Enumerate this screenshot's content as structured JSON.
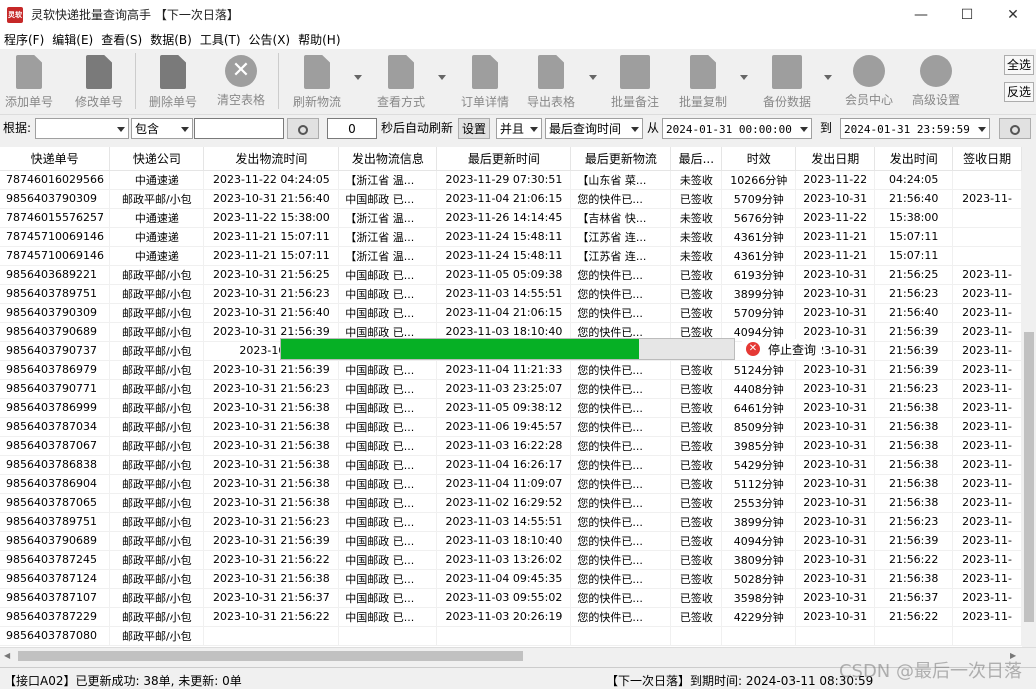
{
  "window": {
    "title": "灵软快递批量查询高手 【下一次日落】",
    "icon_text": "灵软"
  },
  "menu": [
    "程序(F)",
    "编辑(E)",
    "查看(S)",
    "数据(B)",
    "工具(T)",
    "公告(X)",
    "帮助(H)"
  ],
  "toolbar": {
    "add": "添加单号",
    "edit": "修改单号",
    "delete": "删除单号",
    "clear": "清空表格",
    "refresh": "刷新物流",
    "view_mode": "查看方式",
    "detail": "订单详情",
    "export": "导出表格",
    "batch_note": "批量备注",
    "batch_copy": "批量复制",
    "backup": "备份数据",
    "member": "会员中心",
    "settings": "高级设置",
    "select_all": "全选",
    "invert": "反选"
  },
  "search": {
    "by_label": "根据:",
    "by_value": "",
    "match_value": "包含",
    "keyword": "",
    "interval": "0",
    "interval_suffix": "秒后自动刷新",
    "set_btn": "设置",
    "logic": "并且",
    "time_field": "最后查询时间",
    "from_label": "从",
    "from_value": "2024-01-31 00:00:00",
    "to_label": "到",
    "to_value": "2024-01-31 23:59:59"
  },
  "table": {
    "columns": [
      "快递单号",
      "快递公司",
      "发出物流时间",
      "发出物流信息",
      "最后更新时间",
      "最后更新物流",
      "最后...",
      "时效",
      "发出日期",
      "发出时间",
      "签收日期"
    ],
    "rows": [
      [
        "78746016029566",
        "中通速递",
        "2023-11-22 04:24:05",
        "【浙江省 温...",
        "2023-11-29 07:30:51",
        "【山东省 菜...",
        "未签收",
        "10266分钟",
        "2023-11-22",
        "04:24:05",
        ""
      ],
      [
        "9856403790309",
        "邮政平邮/小包",
        "2023-10-31 21:56:40",
        "中国邮政 已...",
        "2023-11-04 21:06:15",
        "您的快件已...",
        "已签收",
        "5709分钟",
        "2023-10-31",
        "21:56:40",
        "2023-11-"
      ],
      [
        "78746015576257",
        "中通速递",
        "2023-11-22 15:38:00",
        "【浙江省 温...",
        "2023-11-26 14:14:45",
        "【吉林省 快...",
        "未签收",
        "5676分钟",
        "2023-11-22",
        "15:38:00",
        ""
      ],
      [
        "78745710069146",
        "中通速递",
        "2023-11-21 15:07:11",
        "【浙江省 温...",
        "2023-11-24 15:48:11",
        "【江苏省 连...",
        "未签收",
        "4361分钟",
        "2023-11-21",
        "15:07:11",
        ""
      ],
      [
        "78745710069146",
        "中通速递",
        "2023-11-21 15:07:11",
        "【浙江省 温...",
        "2023-11-24 15:48:11",
        "【江苏省 连...",
        "未签收",
        "4361分钟",
        "2023-11-21",
        "15:07:11",
        ""
      ],
      [
        "9856403689221",
        "邮政平邮/小包",
        "2023-10-31 21:56:25",
        "中国邮政 已...",
        "2023-11-05 05:09:38",
        "您的快件已...",
        "已签收",
        "6193分钟",
        "2023-10-31",
        "21:56:25",
        "2023-11-"
      ],
      [
        "9856403789751",
        "邮政平邮/小包",
        "2023-10-31 21:56:23",
        "中国邮政 已...",
        "2023-11-03 14:55:51",
        "您的快件已...",
        "已签收",
        "3899分钟",
        "2023-10-31",
        "21:56:23",
        "2023-11-"
      ],
      [
        "9856403790309",
        "邮政平邮/小包",
        "2023-10-31 21:56:40",
        "中国邮政 已...",
        "2023-11-04 21:06:15",
        "您的快件已...",
        "已签收",
        "5709分钟",
        "2023-10-31",
        "21:56:40",
        "2023-11-"
      ],
      [
        "9856403790689",
        "邮政平邮/小包",
        "2023-10-31 21:56:39",
        "中国邮政 已...",
        "2023-11-03 18:10:40",
        "您的快件已...",
        "已签收",
        "4094分钟",
        "2023-10-31",
        "21:56:39",
        "2023-11-"
      ],
      [
        "9856403790737",
        "邮政平邮/小包",
        "2023-10-31",
        "",
        "",
        "",
        "",
        "",
        "2023-10-31",
        "21:56:39",
        "2023-11-"
      ],
      [
        "9856403786979",
        "邮政平邮/小包",
        "2023-10-31 21:56:39",
        "中国邮政 已...",
        "2023-11-04 11:21:33",
        "您的快件已...",
        "已签收",
        "5124分钟",
        "2023-10-31",
        "21:56:39",
        "2023-11-"
      ],
      [
        "9856403790771",
        "邮政平邮/小包",
        "2023-10-31 21:56:23",
        "中国邮政 已...",
        "2023-11-03 23:25:07",
        "您的快件已...",
        "已签收",
        "4408分钟",
        "2023-10-31",
        "21:56:23",
        "2023-11-"
      ],
      [
        "9856403786999",
        "邮政平邮/小包",
        "2023-10-31 21:56:38",
        "中国邮政 已...",
        "2023-11-05 09:38:12",
        "您的快件已...",
        "已签收",
        "6461分钟",
        "2023-10-31",
        "21:56:38",
        "2023-11-"
      ],
      [
        "9856403787034",
        "邮政平邮/小包",
        "2023-10-31 21:56:38",
        "中国邮政 已...",
        "2023-11-06 19:45:57",
        "您的快件已...",
        "已签收",
        "8509分钟",
        "2023-10-31",
        "21:56:38",
        "2023-11-"
      ],
      [
        "9856403787067",
        "邮政平邮/小包",
        "2023-10-31 21:56:38",
        "中国邮政 已...",
        "2023-11-03 16:22:28",
        "您的快件已...",
        "已签收",
        "3985分钟",
        "2023-10-31",
        "21:56:38",
        "2023-11-"
      ],
      [
        "9856403786838",
        "邮政平邮/小包",
        "2023-10-31 21:56:38",
        "中国邮政 已...",
        "2023-11-04 16:26:17",
        "您的快件已...",
        "已签收",
        "5429分钟",
        "2023-10-31",
        "21:56:38",
        "2023-11-"
      ],
      [
        "9856403786904",
        "邮政平邮/小包",
        "2023-10-31 21:56:38",
        "中国邮政 已...",
        "2023-11-04 11:09:07",
        "您的快件已...",
        "已签收",
        "5112分钟",
        "2023-10-31",
        "21:56:38",
        "2023-11-"
      ],
      [
        "9856403787065",
        "邮政平邮/小包",
        "2023-10-31 21:56:38",
        "中国邮政 已...",
        "2023-11-02 16:29:52",
        "您的快件已...",
        "已签收",
        "2553分钟",
        "2023-10-31",
        "21:56:38",
        "2023-11-"
      ],
      [
        "9856403789751",
        "邮政平邮/小包",
        "2023-10-31 21:56:23",
        "中国邮政 已...",
        "2023-11-03 14:55:51",
        "您的快件已...",
        "已签收",
        "3899分钟",
        "2023-10-31",
        "21:56:23",
        "2023-11-"
      ],
      [
        "9856403790689",
        "邮政平邮/小包",
        "2023-10-31 21:56:39",
        "中国邮政 已...",
        "2023-11-03 18:10:40",
        "您的快件已...",
        "已签收",
        "4094分钟",
        "2023-10-31",
        "21:56:39",
        "2023-11-"
      ],
      [
        "9856403787245",
        "邮政平邮/小包",
        "2023-10-31 21:56:22",
        "中国邮政 已...",
        "2023-11-03 13:26:02",
        "您的快件已...",
        "已签收",
        "3809分钟",
        "2023-10-31",
        "21:56:22",
        "2023-11-"
      ],
      [
        "9856403787124",
        "邮政平邮/小包",
        "2023-10-31 21:56:38",
        "中国邮政 已...",
        "2023-11-04 09:45:35",
        "您的快件已...",
        "已签收",
        "5028分钟",
        "2023-10-31",
        "21:56:38",
        "2023-11-"
      ],
      [
        "9856403787107",
        "邮政平邮/小包",
        "2023-10-31 21:56:37",
        "中国邮政 已...",
        "2023-11-03 09:55:02",
        "您的快件已...",
        "已签收",
        "3598分钟",
        "2023-10-31",
        "21:56:37",
        "2023-11-"
      ],
      [
        "9856403787229",
        "邮政平邮/小包",
        "2023-10-31 21:56:22",
        "中国邮政 已...",
        "2023-11-03 20:26:19",
        "您的快件已...",
        "已签收",
        "4229分钟",
        "2023-10-31",
        "21:56:22",
        "2023-11-"
      ],
      [
        "9856403787080",
        "邮政平邮/小包",
        "",
        "",
        "",
        "",
        "",
        "",
        "",
        "",
        ""
      ]
    ]
  },
  "progress": {
    "fraction": 0.79,
    "stop_label": "停止查询",
    "color": "#06b025"
  },
  "status": {
    "left": "【接口A02】已更新成功: 38单, 未更新: 0单",
    "right": "【下一次日落】到期时间: 2024-03-11 08:30:59"
  },
  "watermark": "CSDN @最后一次日落"
}
